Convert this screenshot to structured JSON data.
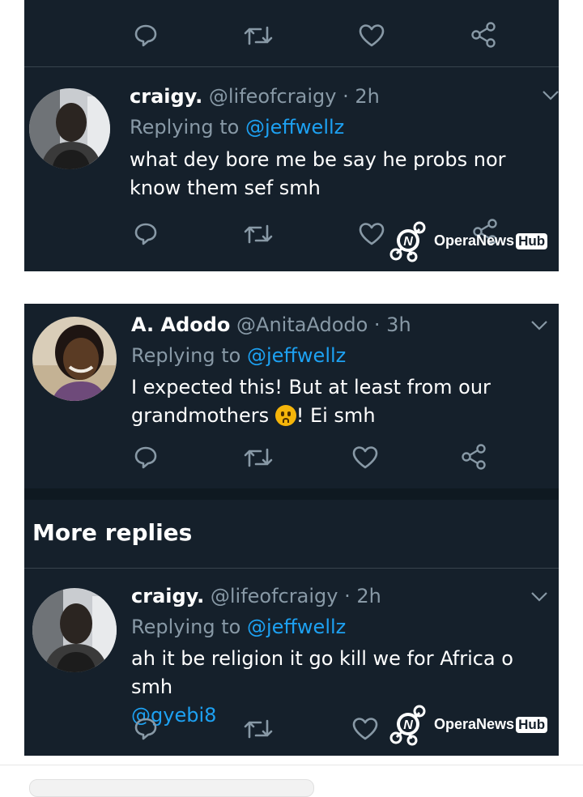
{
  "panel1": {
    "tweet_top": {
      "actions": [
        "reply-icon",
        "retweet-icon",
        "like-icon",
        "share-icon"
      ]
    },
    "tweet_craigy_1": {
      "name": "craigy.",
      "meta": "@lifeofcraigy · 2h",
      "replying_prefix": "Replying to",
      "replying_handle": "@jeffwellz",
      "text": "what dey bore me be say he probs nor know them sef smh"
    }
  },
  "panel2": {
    "tweet_adodo": {
      "name": "A. Adodo",
      "meta": "@AnitaAdodo · 3h",
      "replying_prefix": "Replying to",
      "replying_handle": "@jeffwellz",
      "text_before_emoji": "I expected this! But at least from our grandmothers",
      "emoji": "worried-face-emoji",
      "text_after_emoji": "! Ei smh"
    },
    "more_replies_label": "More replies",
    "tweet_craigy_2": {
      "name": "craigy.",
      "meta": "@lifeofcraigy · 2h",
      "replying_prefix": "Replying to",
      "replying_handle": "@jeffwellz",
      "text": "ah it be religion it go kill we for Africa o smh",
      "mention": "@gyebi8"
    }
  },
  "watermark": {
    "brand_prefix": "Opera",
    "brand_middle": "News",
    "brand_badge": "Hub"
  },
  "colors": {
    "background": "#15202b",
    "link": "#1da1f2",
    "muted": "#8899a6",
    "divider": "#38444d"
  }
}
